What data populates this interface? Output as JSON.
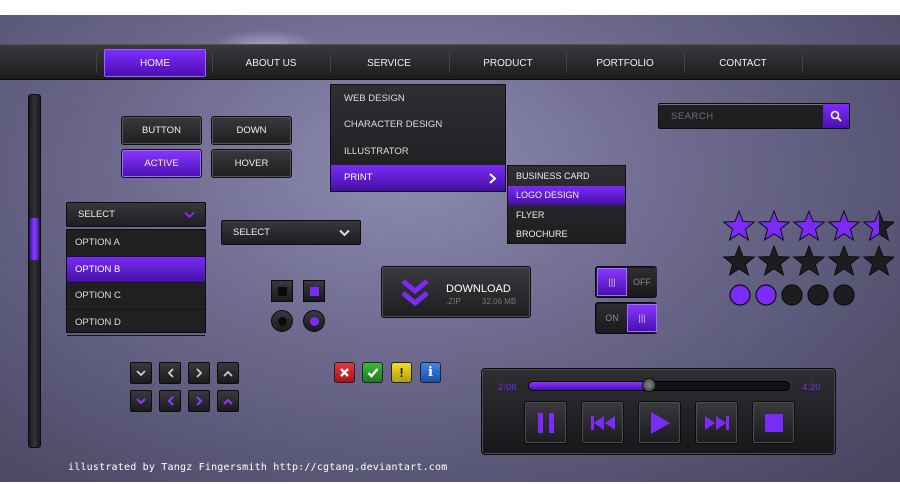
{
  "nav": {
    "items": [
      "HOME",
      "ABOUT US",
      "SERVICE",
      "PRODUCT",
      "PORTFOLIO",
      "CONTACT"
    ],
    "active_index": 0
  },
  "menu": {
    "items": [
      "WEB DESIGN",
      "CHARACTER DESIGN",
      "ILLUSTRATOR",
      "PRINT"
    ],
    "active_index": 3,
    "submenu": [
      "BUSINESS CARD",
      "LOGO DESIGN",
      "FLYER",
      "BROCHURE"
    ],
    "submenu_active_index": 1
  },
  "search": {
    "placeholder": "SEARCH"
  },
  "buttons": {
    "normal": "BUTTON",
    "down": "DOWN",
    "active": "ACTIVE",
    "hover": "HOVER"
  },
  "select_open": {
    "label": "SELECT",
    "options": [
      "OPTION A",
      "OPTION B",
      "OPTION C",
      "OPTION D"
    ],
    "active_index": 1
  },
  "select_closed": {
    "label": "SELECT"
  },
  "download": {
    "title": "DOWNLOAD",
    "ext": ".ZIP",
    "size": "32.06 MB"
  },
  "toggles": {
    "off_label": "OFF",
    "on_label": "ON",
    "grip": "|||"
  },
  "rating": {
    "row1_value": 4.5,
    "row2_value": 0,
    "max": 5,
    "dots_filled": 2,
    "dots_total": 5
  },
  "player": {
    "elapsed": "2:06",
    "total": "4:20",
    "progress": 0.46
  },
  "credit": "illustrated by Tangz Fingersmith http://cgtang.deviantart.com",
  "colors": {
    "accent": "#7a2bf7",
    "red": "#c8202a",
    "green": "#2f9a2a",
    "yellow": "#d8c21a",
    "blue": "#2b6fd2"
  }
}
